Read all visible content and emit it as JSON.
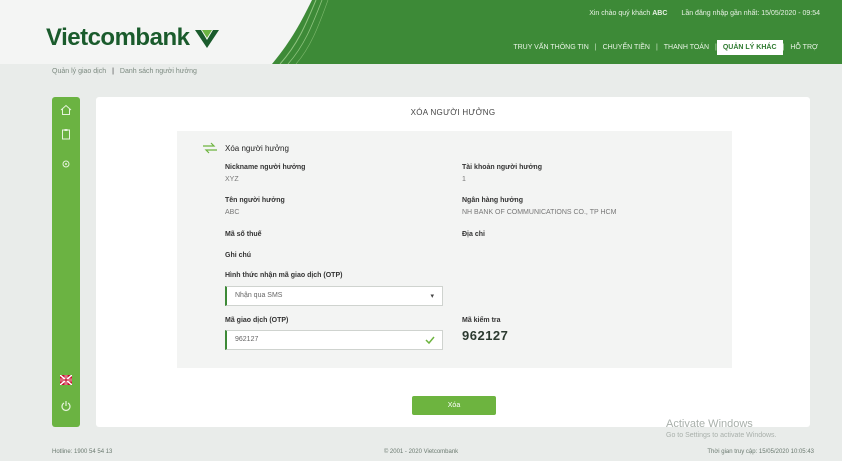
{
  "header": {
    "logo_text": "Vietcombank",
    "greeting_label": "Xin chào quý khách",
    "greeting_name": "ABC",
    "last_login": "Lần đăng nhập gần nhất: 15/05/2020 - 09:54",
    "nav": [
      {
        "label": "TRUY VẤN THÔNG TIN",
        "active": false
      },
      {
        "label": "CHUYỂN TIỀN",
        "active": false
      },
      {
        "label": "THANH TOÁN",
        "active": false
      },
      {
        "label": "QUẢN LÝ KHÁC",
        "active": true
      },
      {
        "label": "HỖ TRỢ",
        "active": false
      }
    ]
  },
  "breadcrumb": {
    "home": "Quản lý giao dịch",
    "current": "Danh sách người hưởng"
  },
  "sidebar": {
    "icons": [
      "home-icon",
      "clipboard-icon",
      "settings-icon",
      "flag-icon",
      "power-icon"
    ]
  },
  "page": {
    "title": "XÓA NGƯỜI HƯỞNG",
    "section_title": "Xóa người hưởng"
  },
  "form": {
    "nickname_label": "Nickname người hưởng",
    "nickname_value": "XYZ",
    "account_label": "Tài khoản người hưởng",
    "account_value": "1",
    "name_label": "Tên người hưởng",
    "name_value": "ABC",
    "bank_label": "Ngân hàng hưởng",
    "bank_value": "NH BANK OF COMMUNICATIONS CO., TP HCM",
    "tax_label": "Mã số thuế",
    "address_label": "Địa chỉ",
    "note_label": "Ghi chú",
    "otp_method_label": "Hình thức nhận mã giao dịch (OTP)",
    "otp_method_value": "Nhận qua SMS",
    "otp_label": "Mã giao dịch (OTP)",
    "otp_value": "962127",
    "captcha_label": "Mã kiểm tra",
    "captcha_value": "962127"
  },
  "actions": {
    "delete_label": "Xóa"
  },
  "watermark": {
    "title": "Activate Windows",
    "subtitle": "Go to Settings to activate Windows."
  },
  "footer": {
    "left": "Hotline: 1900 54 54 13",
    "center": "© 2001 - 2020 Vietcombank",
    "right": "Thời gian truy cập: 15/05/2020 10:05:43"
  },
  "colors": {
    "brand_green": "#3d8a37",
    "sidebar_green": "#6bb342",
    "button_green": "#6db43f",
    "logo_dark_green": "#1a5b2c"
  }
}
